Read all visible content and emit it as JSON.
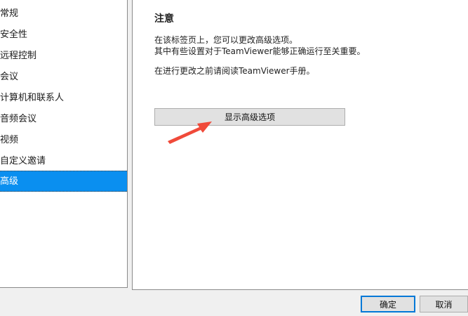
{
  "sidebar": {
    "items": [
      {
        "label": "常规"
      },
      {
        "label": "安全性"
      },
      {
        "label": "远程控制"
      },
      {
        "label": "会议"
      },
      {
        "label": "计算机和联系人"
      },
      {
        "label": "音频会议"
      },
      {
        "label": "视频"
      },
      {
        "label": "自定义邀请"
      },
      {
        "label": "高级"
      }
    ],
    "selected_index": 8,
    "selected_color": "#0a8ff0"
  },
  "panel": {
    "title": "注意",
    "line1": "在该标签页上，您可以更改高级选项。",
    "line2": "其中有些设置对于TeamViewer能够正确运行至关重要。",
    "line3": "在进行更改之前请阅读TeamViewer手册。",
    "show_advanced_button": "显示高级选项"
  },
  "annotation": {
    "arrow_color": "#f04a3a"
  },
  "footer": {
    "ok_label": "确定",
    "cancel_label": "取消"
  }
}
